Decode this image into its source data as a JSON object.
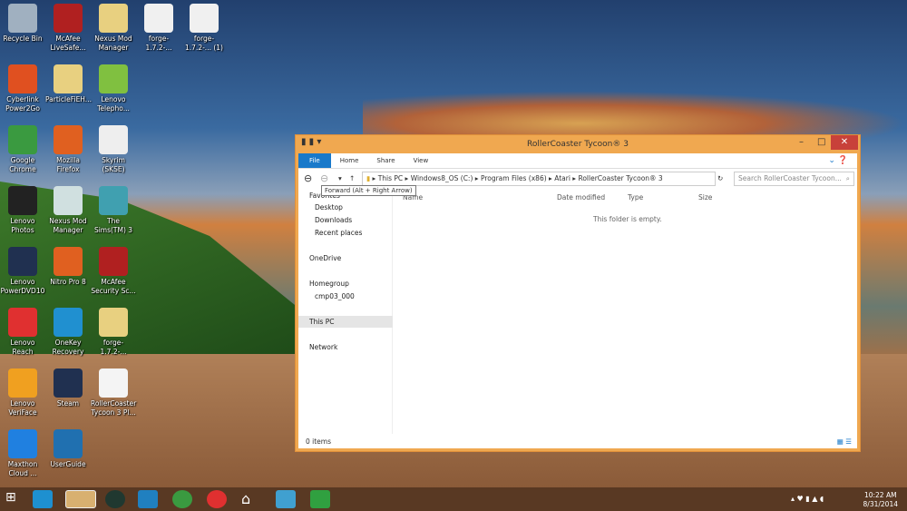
{
  "desktop_icons": [
    {
      "label": "Recycle Bin",
      "col": 0,
      "row": 0,
      "color": "#a0b0c0"
    },
    {
      "label": "Cyberlink Power2Go",
      "col": 0,
      "row": 1,
      "color": "#e05020"
    },
    {
      "label": "Google Chrome",
      "col": 0,
      "row": 2,
      "color": "#3a9a40"
    },
    {
      "label": "Lenovo Photos",
      "col": 0,
      "row": 3,
      "color": "#222"
    },
    {
      "label": "Lenovo PowerDVD10",
      "col": 0,
      "row": 4,
      "color": "#203050"
    },
    {
      "label": "Lenovo Reach",
      "col": 0,
      "row": 5,
      "color": "#e03030"
    },
    {
      "label": "Lenovo VeriFace",
      "col": 0,
      "row": 6,
      "color": "#f0a020"
    },
    {
      "label": "Maxthon Cloud ...",
      "col": 0,
      "row": 7,
      "color": "#2080e0"
    },
    {
      "label": "McAfee LiveSafe...",
      "col": 1,
      "row": 0,
      "color": "#b02020"
    },
    {
      "label": "ParticleFiEH...",
      "col": 1,
      "row": 1,
      "color": "#e8d080"
    },
    {
      "label": "Mozilla Firefox",
      "col": 1,
      "row": 2,
      "color": "#e06020"
    },
    {
      "label": "Nexus Mod Manager",
      "col": 1,
      "row": 3,
      "color": "#d0e0e0"
    },
    {
      "label": "Nitro Pro 8",
      "col": 1,
      "row": 4,
      "color": "#e06020"
    },
    {
      "label": "OneKey Recovery",
      "col": 1,
      "row": 5,
      "color": "#2090d0"
    },
    {
      "label": "Steam",
      "col": 1,
      "row": 6,
      "color": "#203050"
    },
    {
      "label": "UserGuide",
      "col": 1,
      "row": 7,
      "color": "#2070b0"
    },
    {
      "label": "Nexus Mod Manager",
      "col": 2,
      "row": 0,
      "color": "#e8d080"
    },
    {
      "label": "Lenovo Telepho...",
      "col": 2,
      "row": 1,
      "color": "#80c040"
    },
    {
      "label": "Skyrim (SKSE)",
      "col": 2,
      "row": 2,
      "color": "#eee"
    },
    {
      "label": "The Sims(TM) 3",
      "col": 2,
      "row": 3,
      "color": "#40a0b0"
    },
    {
      "label": "McAfee Security Sc...",
      "col": 2,
      "row": 4,
      "color": "#b02020"
    },
    {
      "label": "forge-1.7.2-...",
      "col": 2,
      "row": 5,
      "color": "#e8d080"
    },
    {
      "label": "RollerCoaster Tycoon 3 Pl...",
      "col": 2,
      "row": 6,
      "color": "#f4f4f4"
    },
    {
      "label": "forge-1.7.2-...",
      "col": 3,
      "row": 0,
      "color": "#f0f0f0"
    },
    {
      "label": "forge-1.7.2-... (1)",
      "col": 4,
      "row": 0,
      "color": "#f0f0f0"
    }
  ],
  "explorer": {
    "title": "RollerCoaster Tycoon® 3",
    "ribbon_tabs": [
      "File",
      "Home",
      "Share",
      "View"
    ],
    "breadcrumb": [
      "This PC",
      "Windows8_OS (C:)",
      "Program Files (x86)",
      "Atari",
      "RollerCoaster Tycoon® 3"
    ],
    "search_placeholder": "Search RollerCoaster Tycoon...",
    "tooltip": "Forward (Alt + Right Arrow)",
    "nav": [
      {
        "label": "Favorites"
      },
      {
        "label": "Desktop"
      },
      {
        "label": "Downloads"
      },
      {
        "label": "Recent places"
      },
      {
        "label": "OneDrive"
      },
      {
        "label": "Homegroup"
      },
      {
        "label": "cmp03_000"
      },
      {
        "label": "This PC"
      },
      {
        "label": "Network"
      }
    ],
    "columns": [
      "Name",
      "Date modified",
      "Type",
      "Size"
    ],
    "empty_text": "This folder is empty.",
    "status": "0 items"
  },
  "clock": {
    "time": "10:22 AM",
    "date": "8/31/2014"
  }
}
